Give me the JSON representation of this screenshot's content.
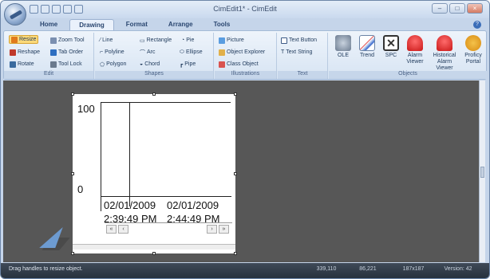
{
  "window": {
    "title": "CimEdit1* - CimEdit"
  },
  "tabs": [
    "Home",
    "Drawing",
    "Format",
    "Arrange",
    "Tools"
  ],
  "active_tab": "Drawing",
  "ribbon": {
    "edit": {
      "label": "Edit",
      "items": [
        "Resize",
        "Zoom Tool",
        "Reshape",
        "Tab Order",
        "Rotate",
        "Tool Lock"
      ]
    },
    "shapes": {
      "label": "Shapes",
      "items": [
        "Line",
        "Rectangle",
        "Pie",
        "Polyline",
        "Arc",
        "Ellipse",
        "Polygon",
        "Chord",
        "Pipe"
      ]
    },
    "illustrations": {
      "label": "Illustrations",
      "items": [
        "Picture",
        "Object Explorer",
        "Class Object"
      ]
    },
    "text": {
      "label": "Text",
      "items": [
        "Text Button",
        "Text String"
      ]
    },
    "objects": {
      "label": "Objects",
      "items": [
        "OLE",
        "Trend",
        "SPC",
        "Alarm Viewer",
        "Historical Alarm Viewer",
        "Proficy Portal"
      ]
    }
  },
  "trend": {
    "y_max": "100",
    "y_min": "0",
    "x_labels": [
      [
        "02/01/2009",
        "2:39:49 PM"
      ],
      [
        "02/01/2009",
        "2:44:49 PM"
      ]
    ],
    "nav": [
      "«",
      "‹",
      "›",
      "»"
    ]
  },
  "status": {
    "message": "Drag handles to resize object.",
    "coords": "339,110",
    "pos": "86,221",
    "size": "187x187",
    "version": "Version: 42"
  },
  "colors": {
    "accent": "#fbd97a",
    "canvas": "#575757"
  }
}
